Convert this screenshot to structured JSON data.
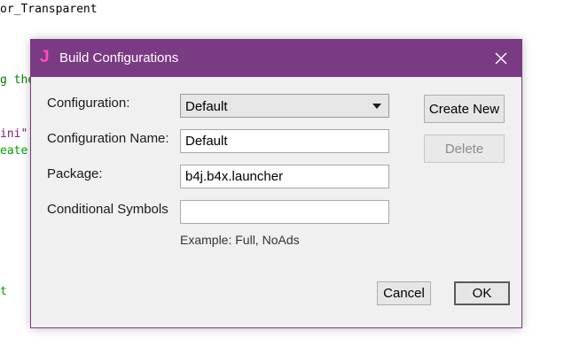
{
  "editor": {
    "lines": [
      {
        "text": "or_Transparent",
        "color": "black"
      },
      {
        "text": "g the",
        "color": "green"
      },
      {
        "text": "ini\")",
        "color": "purple"
      },
      {
        "text": "eate",
        "color": "green"
      },
      {
        "text": "t",
        "color": "green"
      }
    ]
  },
  "dialog": {
    "title": "Build Configurations",
    "app_icon": "J",
    "close_icon": "close-icon",
    "fields": {
      "configuration_label": "Configuration:",
      "configuration_value": "Default",
      "configuration_name_label": "Configuration Name:",
      "configuration_name_value": "Default",
      "package_label": "Package:",
      "package_value": "b4j.b4x.launcher",
      "conditional_symbols_label": "Conditional Symbols",
      "conditional_symbols_value": ""
    },
    "hint": "Example: Full, NoAds",
    "buttons": {
      "create_new": "Create New",
      "delete": "Delete",
      "cancel": "Cancel",
      "ok": "OK"
    }
  },
  "colors": {
    "titlebar": "#7b3a84",
    "app_icon": "#ff4fb8",
    "dialog_bg": "#f0f0f0"
  }
}
